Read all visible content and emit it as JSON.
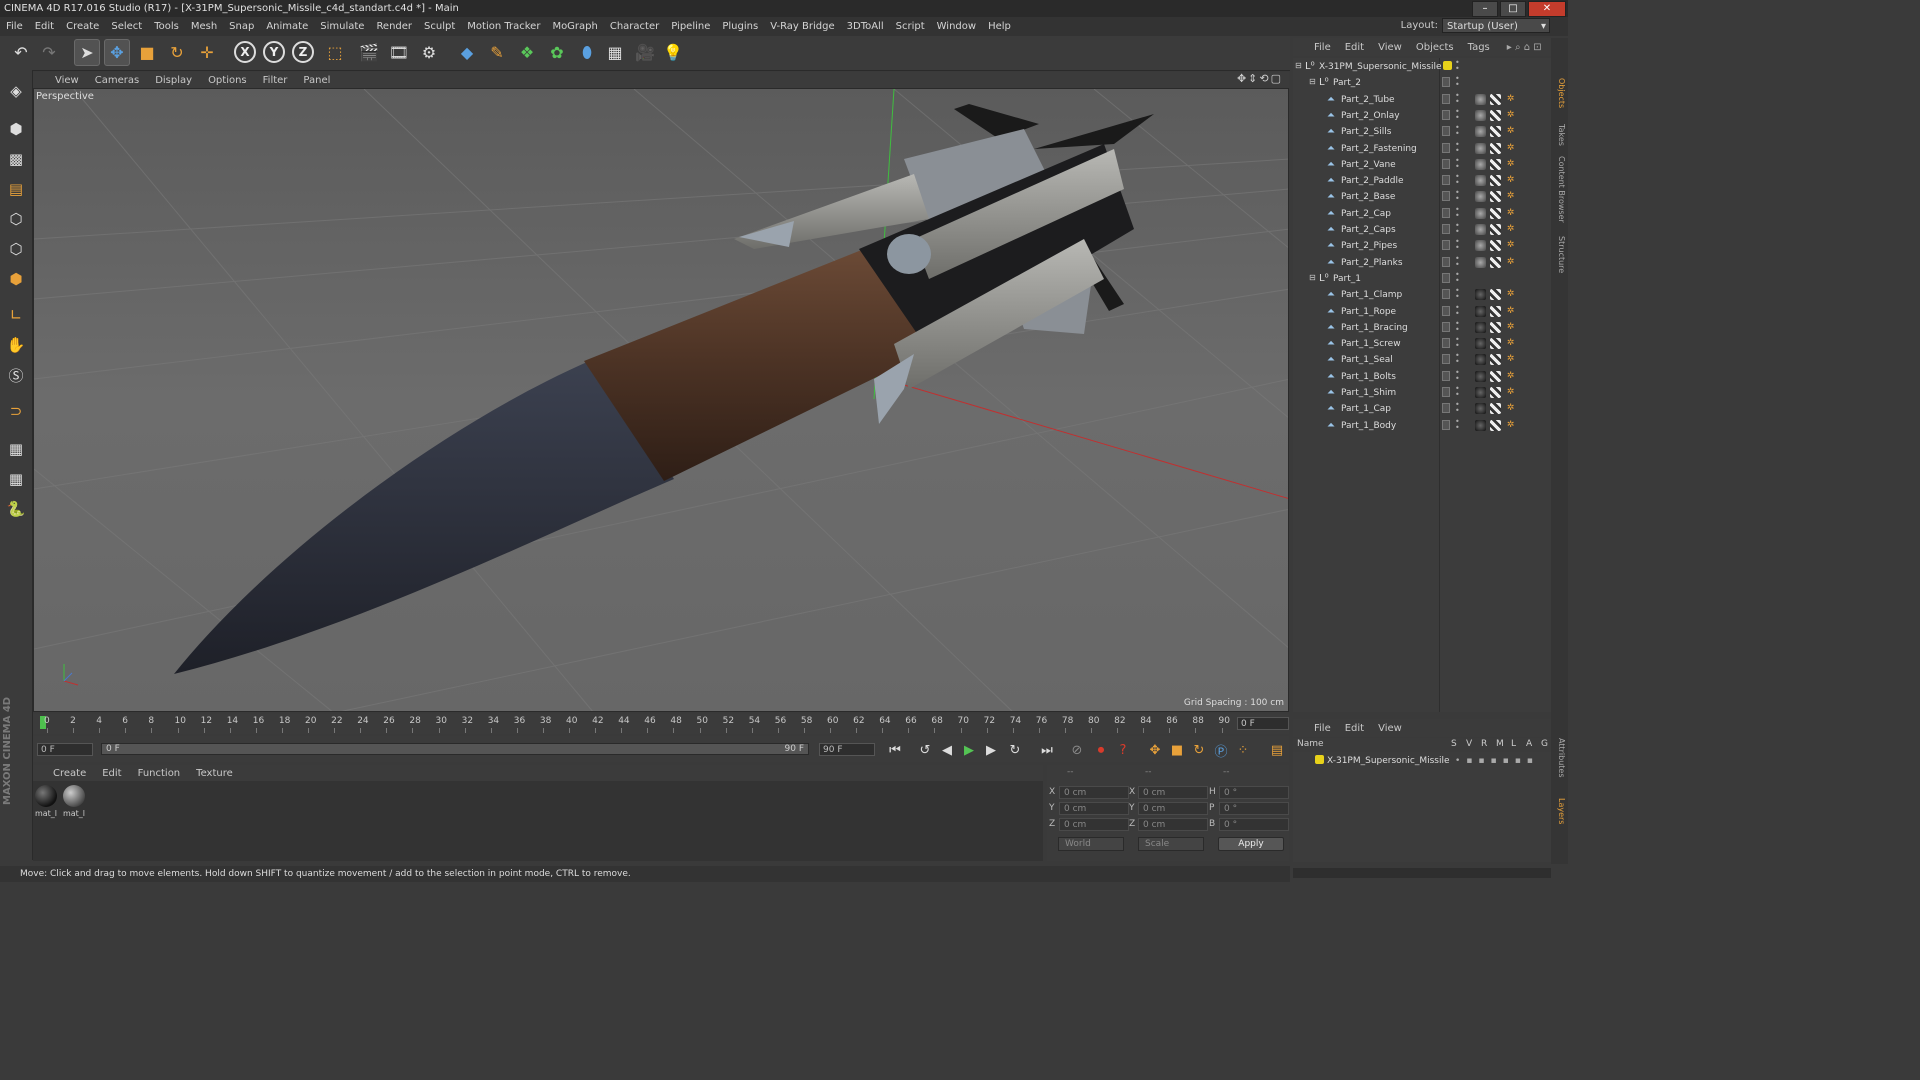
{
  "window": {
    "title": "CINEMA 4D R17.016 Studio (R17) - [X-31PM_Supersonic_Missile_c4d_standart.c4d *] - Main"
  },
  "menubar": [
    "File",
    "Edit",
    "Create",
    "Select",
    "Tools",
    "Mesh",
    "Snap",
    "Animate",
    "Simulate",
    "Render",
    "Sculpt",
    "Motion Tracker",
    "MoGraph",
    "Character",
    "Pipeline",
    "Plugins",
    "V-Ray Bridge",
    "3DToAll",
    "Script",
    "Window",
    "Help"
  ],
  "layout": {
    "label": "Layout:",
    "value": "Startup (User)"
  },
  "toolbar": {
    "axis_x": "X",
    "axis_y": "Y",
    "axis_z": "Z"
  },
  "viewport": {
    "menu": [
      "View",
      "Cameras",
      "Display",
      "Options",
      "Filter",
      "Panel"
    ],
    "label": "Perspective",
    "grid_spacing": "Grid Spacing : 100 cm"
  },
  "timeline": {
    "ticks": [
      "0",
      "2",
      "4",
      "6",
      "8",
      "10",
      "12",
      "14",
      "16",
      "18",
      "20",
      "22",
      "24",
      "26",
      "28",
      "30",
      "32",
      "34",
      "36",
      "38",
      "40",
      "42",
      "44",
      "46",
      "48",
      "50",
      "52",
      "54",
      "56",
      "58",
      "60",
      "62",
      "64",
      "66",
      "68",
      "70",
      "72",
      "74",
      "76",
      "78",
      "80",
      "82",
      "84",
      "86",
      "88",
      "90"
    ],
    "current_frame": "0 F",
    "start_field": "0 F",
    "range_start": "0 F",
    "range_end": "90 F",
    "end_field": "90 F"
  },
  "materials": {
    "menu": [
      "Create",
      "Edit",
      "Function",
      "Texture"
    ],
    "items": [
      {
        "label": "mat_l"
      },
      {
        "label": "mat_l"
      }
    ]
  },
  "coords": {
    "header": [
      "--",
      "--",
      "--"
    ],
    "rows": [
      {
        "a": "X",
        "av": "0 cm",
        "b": "X",
        "bv": "0 cm",
        "c": "H",
        "cv": "0 °"
      },
      {
        "a": "Y",
        "av": "0 cm",
        "b": "Y",
        "bv": "0 cm",
        "c": "P",
        "cv": "0 °"
      },
      {
        "a": "Z",
        "av": "0 cm",
        "b": "Z",
        "bv": "0 cm",
        "c": "B",
        "cv": "0 °"
      }
    ],
    "space": "World",
    "mode": "Scale",
    "apply": "Apply"
  },
  "status": "Move: Click and drag to move elements. Hold down SHIFT to quantize movement / add to the selection in point mode, CTRL to remove.",
  "objects": {
    "menu": [
      "File",
      "Edit",
      "View",
      "Objects",
      "Tags"
    ],
    "root": "X-31PM_Supersonic_Missile",
    "groups": [
      {
        "name": "Part_2",
        "children": [
          "Part_2_Tube",
          "Part_2_Onlay",
          "Part_2_Sills",
          "Part_2_Fastening",
          "Part_2_Vane",
          "Part_2_Paddle",
          "Part_2_Base",
          "Part_2_Cap",
          "Part_2_Caps",
          "Part_2_Pipes",
          "Part_2_Planks"
        ]
      },
      {
        "name": "Part_1",
        "children": [
          "Part_1_Clamp",
          "Part_1_Rope",
          "Part_1_Bracing",
          "Part_1_Screw",
          "Part_1_Seal",
          "Part_1_Bolts",
          "Part_1_Shim",
          "Part_1_Cap",
          "Part_1_Body"
        ]
      }
    ]
  },
  "side_tabs": [
    "Objects",
    "Takes",
    "Content Browser",
    "Structure",
    "Attributes",
    "Layers"
  ],
  "layers": {
    "menu": [
      "File",
      "Edit",
      "View"
    ],
    "header_name": "Name",
    "header_cols": [
      "S",
      "V",
      "R",
      "M",
      "L",
      "A",
      "G"
    ],
    "items": [
      "X-31PM_Supersonic_Missile"
    ]
  },
  "colors": {
    "accent_orange": "#e8a13a",
    "layer_yellow": "#e8d21a",
    "play_green": "#54c454"
  },
  "brand": "MAXON CINEMA 4D"
}
